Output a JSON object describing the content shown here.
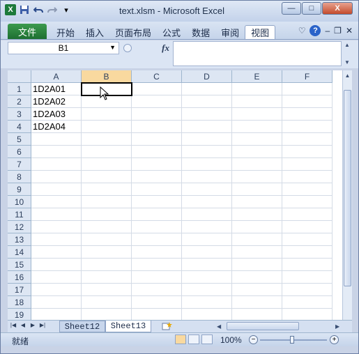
{
  "title_bar": {
    "title": "text.xlsm - Microsoft Excel",
    "icons": [
      "excel-logo-icon",
      "save-icon",
      "undo-icon",
      "redo-icon",
      "customize-qat-icon"
    ],
    "buttons": {
      "minimize": "—",
      "maximize": "□",
      "close": "X"
    }
  },
  "ribbon": {
    "file_tab": "文件",
    "tabs": [
      "开始",
      "插入",
      "页面布局",
      "公式",
      "数据",
      "审阅",
      "视图"
    ],
    "active_tab_index": 6
  },
  "formula_bar": {
    "name_box": "B1",
    "fx_label": "fx",
    "formula": ""
  },
  "sheet": {
    "columns": [
      "A",
      "B",
      "C",
      "D",
      "E",
      "F"
    ],
    "selected_column": "B",
    "rows": [
      "1",
      "2",
      "3",
      "4",
      "5",
      "6",
      "7",
      "8",
      "9",
      "10",
      "11",
      "12",
      "13",
      "14",
      "15",
      "16",
      "17",
      "18",
      "19"
    ],
    "column_a_values": [
      "1D2A01",
      "1D2A02",
      "1D2A03",
      "1D2A04"
    ],
    "active_cell": "B1"
  },
  "sheet_tabs": {
    "tabs": [
      "Sheet12",
      "Sheet13"
    ],
    "active_tab": "Sheet13"
  },
  "status_bar": {
    "status": "就绪",
    "zoom": "100%"
  },
  "colors": {
    "file_tab": "#1e6f31",
    "selected_header": "#f9d99f",
    "header_bg": "#dde6f3"
  }
}
